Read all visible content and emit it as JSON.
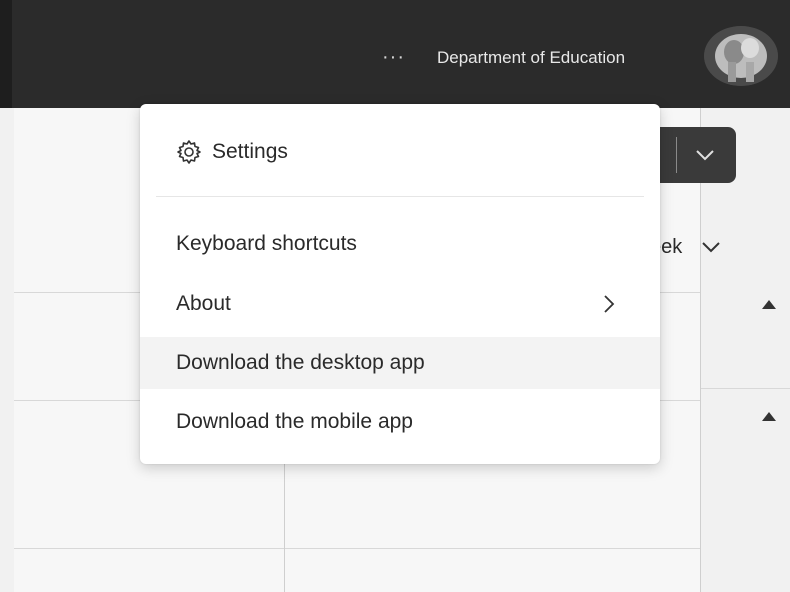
{
  "header": {
    "more_label": "···",
    "org_name": "Department of Education",
    "avatar_icon": "user-avatar"
  },
  "toolbar": {
    "view_label": "eek",
    "dropdown_icon": "chevron-down-icon"
  },
  "menu": {
    "items": [
      {
        "label": "Settings",
        "icon": "gear-icon"
      },
      {
        "label": "Keyboard shortcuts"
      },
      {
        "label": "About",
        "icon": "chevron-right-icon"
      },
      {
        "label": "Download the desktop app"
      },
      {
        "label": "Download the mobile app"
      }
    ]
  },
  "colors": {
    "topbar": "#2b2b2b",
    "menu_bg": "#ffffff",
    "hover_bg": "#f3f3f3"
  }
}
